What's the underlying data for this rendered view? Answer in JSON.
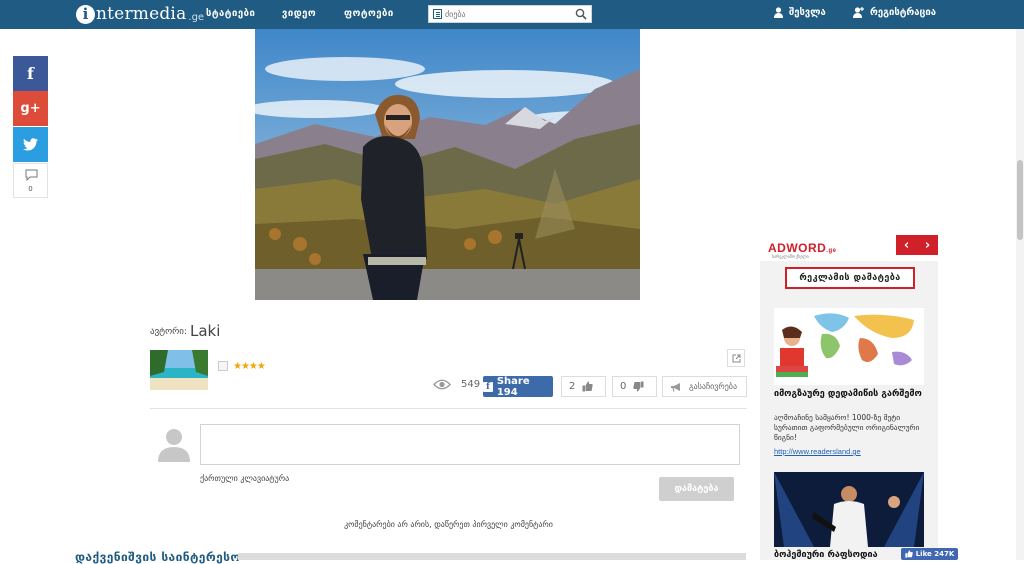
{
  "header": {
    "logo_letter": "i",
    "logo_text": "ntermedia",
    "logo_tld": ".ge",
    "nav": [
      "სტატიები",
      "ვიდეო",
      "ფოტოები"
    ],
    "search_placeholder": "ძიება",
    "login_label": "შესვლა",
    "register_label": "რეგისტრაცია",
    "bar_color": "#1f5b82"
  },
  "social_sidebar": {
    "facebook_icon": "f",
    "googleplus_icon": "g+",
    "twitter_icon": "twitter-bird",
    "comment_count": "0"
  },
  "article": {
    "author_label": "ავტორი:",
    "author_name": "Laki",
    "rating_stars": "★★★★",
    "views": "549",
    "share_label": "Share 194",
    "likes": "2",
    "dislikes": "0",
    "save_label": "გასაჩივრება"
  },
  "comments": {
    "keyboard_label": "ქართული კლავიატურა",
    "add_button": "დამატება",
    "empty_message": "კომენტარები არ არის, დაწერეთ პირველი კომენტარი"
  },
  "bottom_section_title": "დაქვენიშვის საინტერესო",
  "ad_widget": {
    "logo": "ADWORD",
    "logo_tld": ".ge",
    "logo_sub": "სარეკლამო ქსელი",
    "prev_arrow": "‹",
    "next_arrow": "›",
    "add_ad_label": "რეკლამის დამატება",
    "ad1_title": "იმოგზაურე დედამიწის გარშემო",
    "ad1_desc": "აღმოაჩინე სამყარო! 1000-ზე მეტი სურათით გაფორმებული ორიგინალური წიგნი!",
    "ad1_link": "http://www.readersland.ge",
    "ad2_title": "ბოჰემიური რაფსოდია"
  },
  "facebook_like": "Like 247K",
  "colors": {
    "brand_blue": "#1f5b82",
    "facebook": "#3b5998",
    "googleplus": "#dd4b39",
    "twitter": "#2a9ee0",
    "ad_red": "#d0202a",
    "star": "#f1a60e"
  }
}
